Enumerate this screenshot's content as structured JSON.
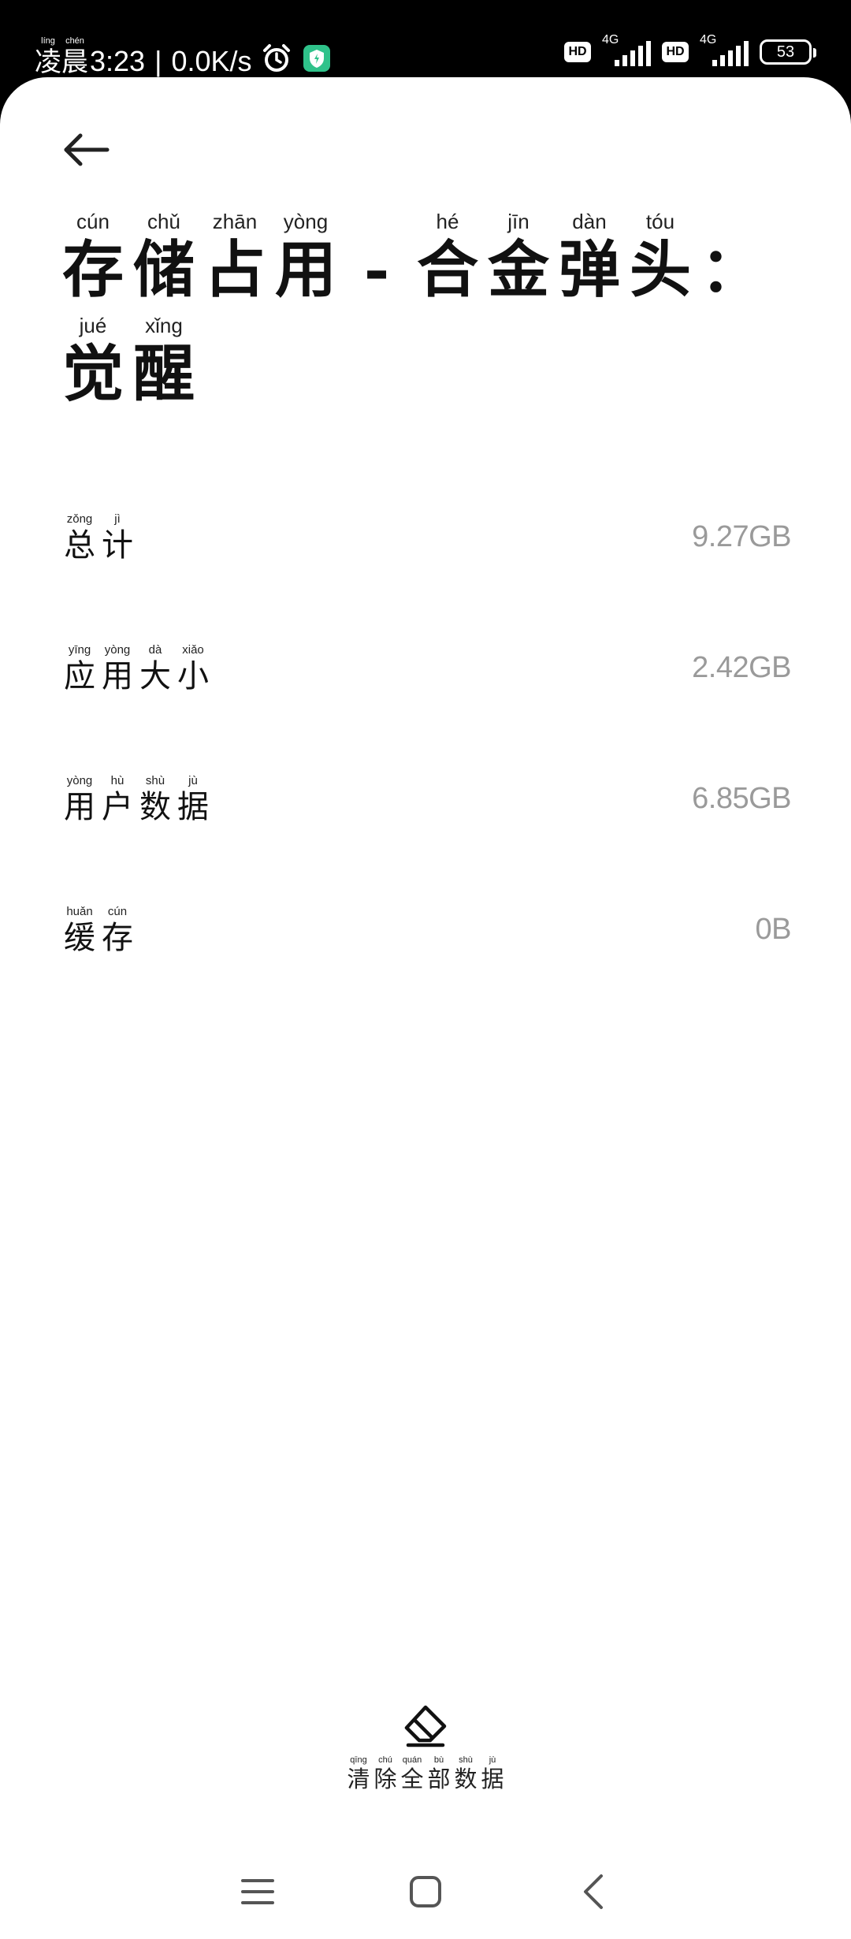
{
  "status_bar": {
    "time_ruby": [
      {
        "py": "líng",
        "ch": "凌"
      },
      {
        "py": "chén",
        "ch": "晨"
      }
    ],
    "time": "3:23",
    "separator": "|",
    "net_speed": "0.0K/s",
    "hd_label": "HD",
    "network_label_1": "4G",
    "network_label_2": "4G",
    "battery": "53"
  },
  "title_ruby": [
    {
      "py": "cún",
      "ch": "存"
    },
    {
      "py": "chǔ",
      "ch": "储"
    },
    {
      "py": "zhān",
      "ch": "占"
    },
    {
      "py": "yòng",
      "ch": "用"
    },
    {
      "py": "",
      "ch": "-"
    },
    {
      "py": "hé",
      "ch": "合"
    },
    {
      "py": "jīn",
      "ch": "金"
    },
    {
      "py": "dàn",
      "ch": "弹"
    },
    {
      "py": "tóu",
      "ch": "头"
    },
    {
      "py": "",
      "ch": "："
    },
    {
      "py": "jué",
      "ch": "觉"
    },
    {
      "py": "xǐng",
      "ch": "醒"
    }
  ],
  "rows": [
    {
      "label_ruby": [
        {
          "py": "zǒng",
          "ch": "总"
        },
        {
          "py": "jì",
          "ch": "计"
        }
      ],
      "value": "9.27GB"
    },
    {
      "label_ruby": [
        {
          "py": "yīng",
          "ch": "应"
        },
        {
          "py": "yòng",
          "ch": "用"
        },
        {
          "py": "dà",
          "ch": "大"
        },
        {
          "py": "xiǎo",
          "ch": "小"
        }
      ],
      "value": "2.42GB"
    },
    {
      "label_ruby": [
        {
          "py": "yòng",
          "ch": "用"
        },
        {
          "py": "hù",
          "ch": "户"
        },
        {
          "py": "shù",
          "ch": "数"
        },
        {
          "py": "jù",
          "ch": "据"
        }
      ],
      "value": "6.85GB"
    },
    {
      "label_ruby": [
        {
          "py": "huǎn",
          "ch": "缓"
        },
        {
          "py": "cún",
          "ch": "存"
        }
      ],
      "value": "0B"
    }
  ],
  "clear_action": {
    "icon": "eraser-icon",
    "label_ruby": [
      {
        "py": "qīng",
        "ch": "清"
      },
      {
        "py": "chú",
        "ch": "除"
      },
      {
        "py": "quán",
        "ch": "全"
      },
      {
        "py": "bù",
        "ch": "部"
      },
      {
        "py": "shù",
        "ch": "数"
      },
      {
        "py": "jù",
        "ch": "据"
      }
    ]
  },
  "nav_icons": [
    "menu-icon",
    "home-icon",
    "back-icon"
  ]
}
